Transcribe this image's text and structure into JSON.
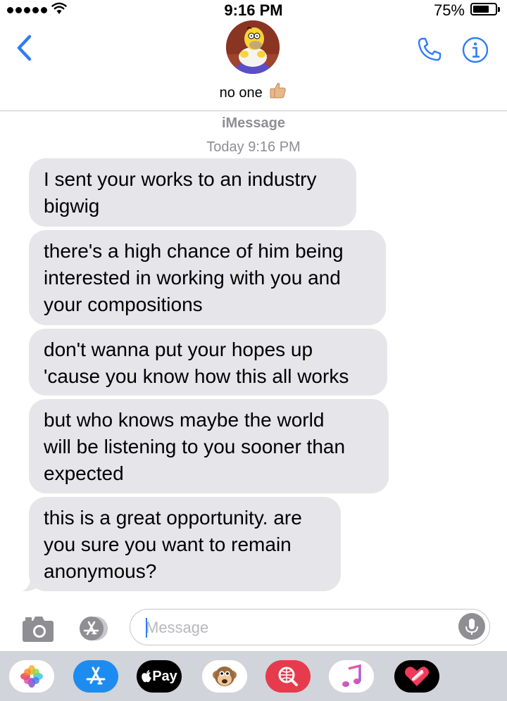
{
  "status_bar": {
    "time": "9:16 PM",
    "battery_percent": "75%",
    "battery_level": 0.75,
    "signal_dots": 5
  },
  "header": {
    "contact_name": "no one",
    "contact_emoji_icon": "thumbs-up-icon",
    "avatar_icon": "homer-avatar-icon",
    "accent_color": "#2f7cf6"
  },
  "thread": {
    "service": "iMessage",
    "timestamp": "Today 9:16 PM",
    "bubble_color": "#e5e5ea",
    "messages": [
      {
        "lines": [
          "I sent your works to an industry",
          "bigwig"
        ]
      },
      {
        "lines": [
          "there's a high chance of him being",
          "interested in working with you and",
          "your compositions"
        ]
      },
      {
        "lines": [
          "don't wanna put your hopes up",
          "'cause you know how this all works"
        ]
      },
      {
        "lines": [
          "but who knows maybe the world",
          "will be listening to you sooner than",
          "expected"
        ]
      },
      {
        "lines": [
          "this is a great opportunity. are",
          "you sure you want to remain",
          "anonymous?"
        ]
      }
    ]
  },
  "composer": {
    "placeholder": "Message",
    "value": ""
  },
  "app_drawer": {
    "apple_pay_label": "Pay",
    "apps": [
      "photos-icon",
      "app-store-icon",
      "apple-pay-icon",
      "animoji-icon",
      "web-search-icon",
      "music-icon",
      "digital-touch-icon"
    ]
  }
}
